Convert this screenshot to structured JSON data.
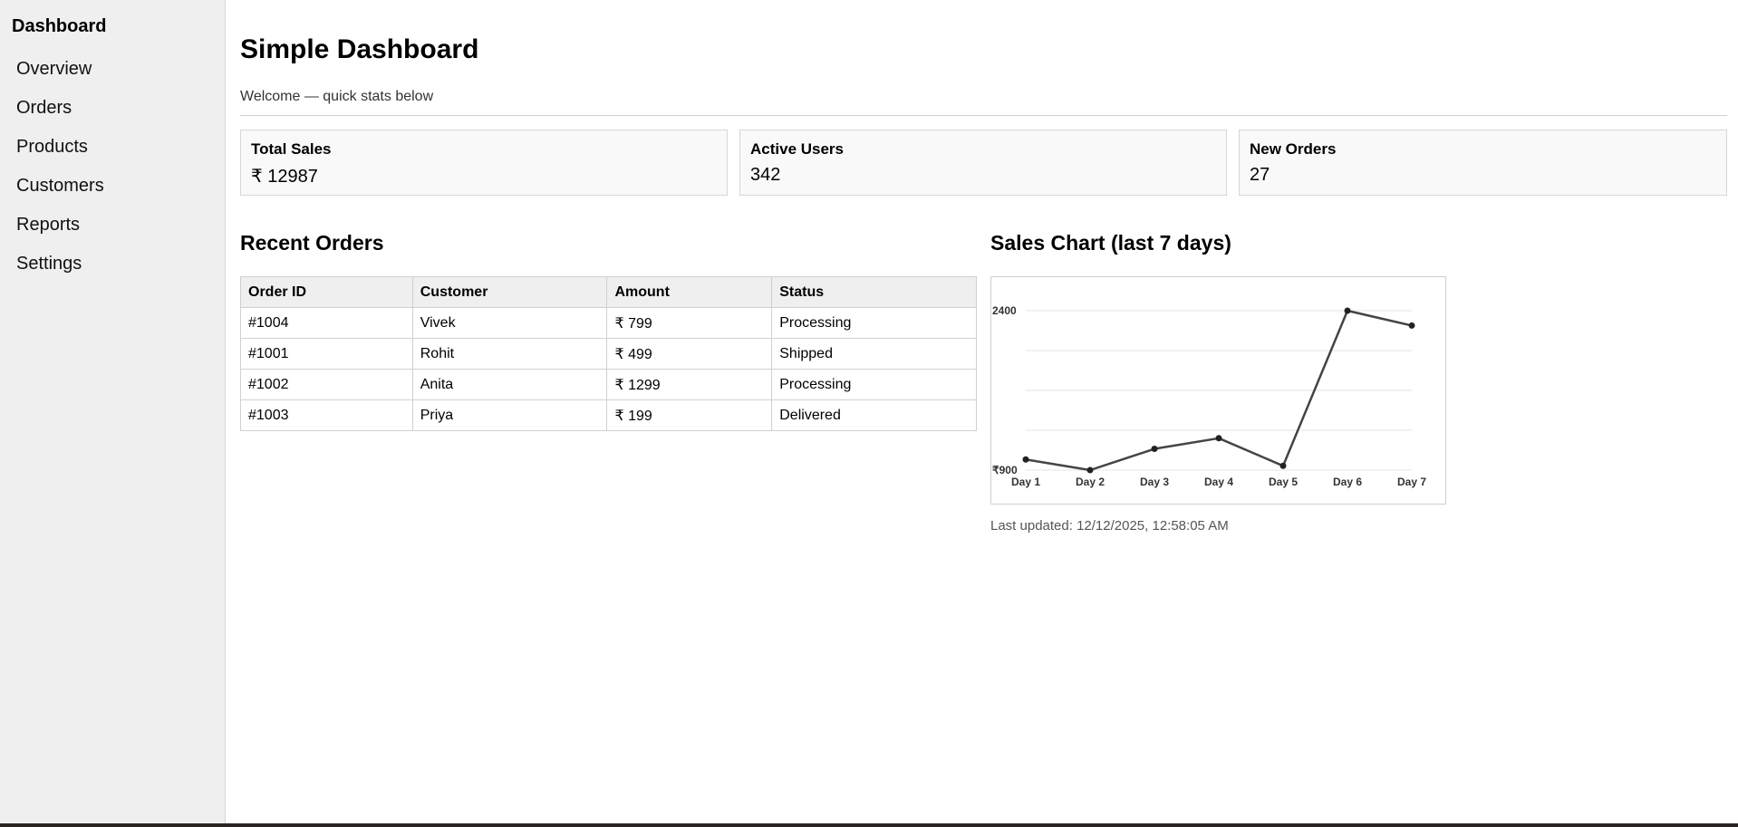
{
  "sidebar": {
    "brand": "Dashboard",
    "items": [
      {
        "label": "Overview"
      },
      {
        "label": "Orders"
      },
      {
        "label": "Products"
      },
      {
        "label": "Customers"
      },
      {
        "label": "Reports"
      },
      {
        "label": "Settings"
      }
    ]
  },
  "header": {
    "title": "Simple Dashboard",
    "subtitle": "Welcome — quick stats below"
  },
  "stats": [
    {
      "label": "Total Sales",
      "value": "₹ 12987"
    },
    {
      "label": "Active Users",
      "value": "342"
    },
    {
      "label": "New Orders",
      "value": "27"
    }
  ],
  "orders": {
    "title": "Recent Orders",
    "columns": [
      "Order ID",
      "Customer",
      "Amount",
      "Status"
    ],
    "rows": [
      [
        "#1004",
        "Vivek",
        "₹ 799",
        "Processing"
      ],
      [
        "#1001",
        "Rohit",
        "₹ 499",
        "Shipped"
      ],
      [
        "#1002",
        "Anita",
        "₹ 1299",
        "Processing"
      ],
      [
        "#1003",
        "Priya",
        "₹ 199",
        "Delivered"
      ]
    ]
  },
  "chart": {
    "title": "Sales Chart (last 7 days)",
    "last_updated": "Last updated: 12/12/2025, 12:58:05 AM"
  },
  "chart_data": {
    "type": "line",
    "title": "Sales Chart (last 7 days)",
    "categories": [
      "Day 1",
      "Day 2",
      "Day 3",
      "Day 4",
      "Day 5",
      "Day 6",
      "Day 7"
    ],
    "series": [
      {
        "values": [
          1000,
          900,
          1100,
          1200,
          940,
          2400,
          2260
        ]
      }
    ],
    "y_tick_labels": [
      "₹900",
      "2400"
    ],
    "ylim": [
      900,
      2400
    ],
    "grid": true,
    "colors": {
      "line": "#444444",
      "grid": "#e5e5e5",
      "axis_text": "#333333"
    }
  }
}
